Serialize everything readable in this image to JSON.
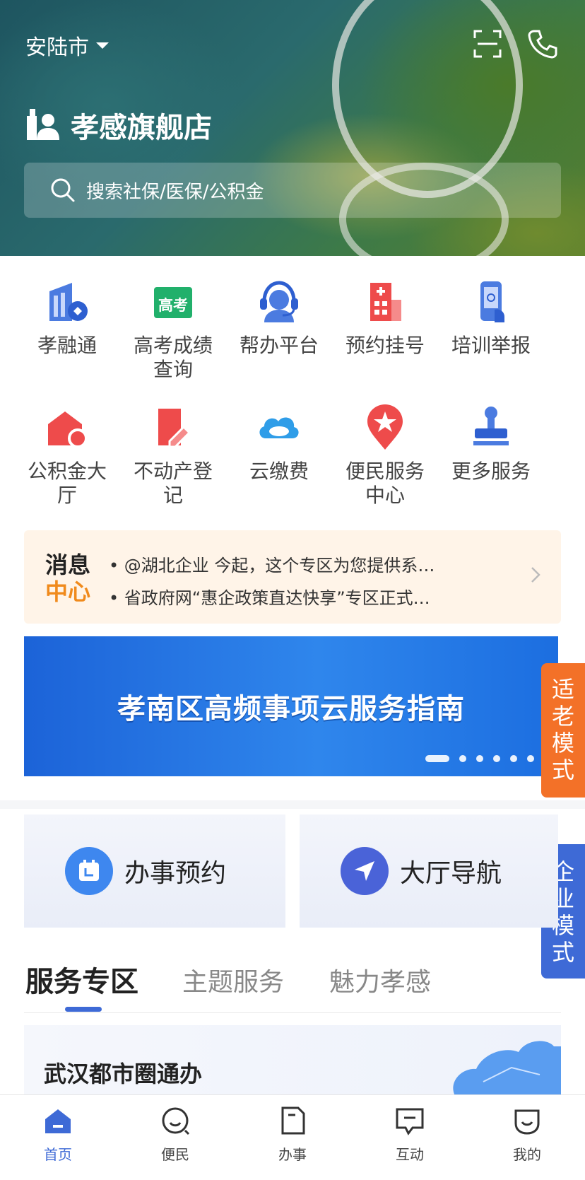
{
  "header": {
    "city": "安陆市",
    "brand": "孝感旗舰店",
    "search_placeholder": "搜索社保/医保/公积金",
    "icons": [
      "scan-icon",
      "phone-icon"
    ]
  },
  "services": [
    {
      "label": "孝融通",
      "icon": "finance-building-icon"
    },
    {
      "label": "高考成绩查询",
      "icon": "gaokao-icon",
      "badge": "高考"
    },
    {
      "label": "帮办平台",
      "icon": "customer-service-icon"
    },
    {
      "label": "预约挂号",
      "icon": "hospital-icon"
    },
    {
      "label": "培训举报",
      "icon": "phone-report-icon"
    },
    {
      "label": "公积金大厅",
      "icon": "house-fund-icon"
    },
    {
      "label": "不动产登记",
      "icon": "property-register-icon"
    },
    {
      "label": "云缴费",
      "icon": "cloud-pay-icon"
    },
    {
      "label": "便民服务中心",
      "icon": "service-center-pin-icon"
    },
    {
      "label": "更多服务",
      "icon": "stamp-icon"
    }
  ],
  "message_center": {
    "tag_top": "消息",
    "tag_bottom": "中心",
    "lines": [
      "• @湖北企业 今起，这个专区为您提供系…",
      "• 省政府网“惠企政策直达快享”专区正式…"
    ]
  },
  "banner": {
    "title": "孝南区高频事项云服务指南",
    "slides": 6,
    "active_slide": 0
  },
  "side_buttons": {
    "elder": "适老模式",
    "business": "企业模式"
  },
  "quick_cards": [
    {
      "label": "办事预约",
      "icon": "calendar-icon"
    },
    {
      "label": "大厅导航",
      "icon": "navigation-icon"
    }
  ],
  "tabs": [
    "服务专区",
    "主题服务",
    "魅力孝感"
  ],
  "active_tab": 0,
  "feature_card": {
    "title": "武汉都市圈通办"
  },
  "bottom_nav": [
    {
      "label": "首页",
      "icon": "home-icon"
    },
    {
      "label": "便民",
      "icon": "smile-icon"
    },
    {
      "label": "办事",
      "icon": "document-icon"
    },
    {
      "label": "互动",
      "icon": "chat-icon"
    },
    {
      "label": "我的",
      "icon": "profile-icon"
    }
  ],
  "colors": {
    "accent": "#3e6ad6",
    "elder": "#f37128",
    "banner": "#2f86ec",
    "message_bg": "#fff4e8"
  }
}
